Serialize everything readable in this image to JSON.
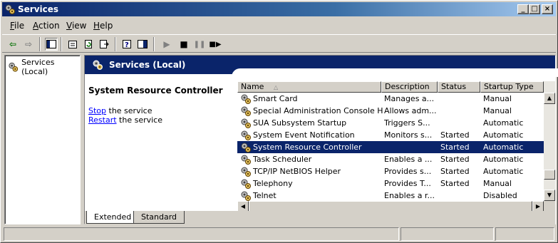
{
  "window": {
    "title": "Services"
  },
  "menu": [
    {
      "key": "F",
      "rest": "ile"
    },
    {
      "key": "A",
      "rest": "ction"
    },
    {
      "key": "V",
      "rest": "iew"
    },
    {
      "key": "H",
      "rest": "elp"
    }
  ],
  "toolbar": {
    "icons": [
      "back-arrow-icon",
      "forward-arrow-icon",
      "show-hide-tree-icon",
      "properties-icon",
      "refresh-icon",
      "export-list-icon",
      "help-icon",
      "show-hide-action-pane-icon",
      "start-service-icon",
      "stop-service-icon",
      "pause-service-icon",
      "restart-service-icon"
    ]
  },
  "tree": {
    "root": "Services (Local)"
  },
  "banner": {
    "title": "Services (Local)"
  },
  "detail": {
    "service_name": "System Resource Controller",
    "stop_link": "Stop",
    "stop_rest": " the service",
    "restart_link": "Restart",
    "restart_rest": " the service"
  },
  "table": {
    "columns": [
      "Name",
      "Description",
      "Status",
      "Startup Type"
    ],
    "sort_column": "Name",
    "selected_row": 4,
    "rows": [
      [
        "Smart Card",
        "Manages a...",
        "",
        "Manual"
      ],
      [
        "Special Administration Console Helper",
        "Allows adm...",
        "",
        "Manual"
      ],
      [
        "SUA Subsystem Startup",
        "Triggers S...",
        "",
        "Automatic"
      ],
      [
        "System Event Notification",
        "Monitors s...",
        "Started",
        "Automatic"
      ],
      [
        "System Resource Controller",
        "",
        "Started",
        "Automatic"
      ],
      [
        "Task Scheduler",
        "Enables a ...",
        "Started",
        "Automatic"
      ],
      [
        "TCP/IP NetBIOS Helper",
        "Provides s...",
        "Started",
        "Automatic"
      ],
      [
        "Telephony",
        "Provides T...",
        "Started",
        "Manual"
      ],
      [
        "Telnet",
        "Enables a r...",
        "",
        "Disabled"
      ]
    ]
  },
  "tabs": [
    "Extended",
    "Standard"
  ],
  "active_tab": "Extended",
  "colors": {
    "selection": "#0a246a",
    "banner": "#0a246a",
    "link": "#0000ff"
  }
}
